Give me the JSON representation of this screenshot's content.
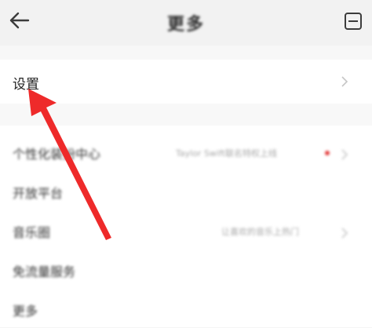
{
  "header": {
    "title": "更多",
    "back_icon": "arrow-left-icon",
    "menu_icon": "menu-icon"
  },
  "settings_row": {
    "label": "设置"
  },
  "items": [
    {
      "label": "个性化装扮中心",
      "sub": "Taylor Swift联名特权上线",
      "has_dot": true
    },
    {
      "label": "开放平台",
      "sub": ""
    },
    {
      "label": "音乐圈",
      "sub": "让喜欢的音乐上热门"
    },
    {
      "label": "免流量服务",
      "sub": ""
    },
    {
      "label": "更多",
      "sub": ""
    }
  ],
  "colors": {
    "arrow": "#ee2a2a",
    "background": "#f5f5f5",
    "row": "#ffffff"
  }
}
